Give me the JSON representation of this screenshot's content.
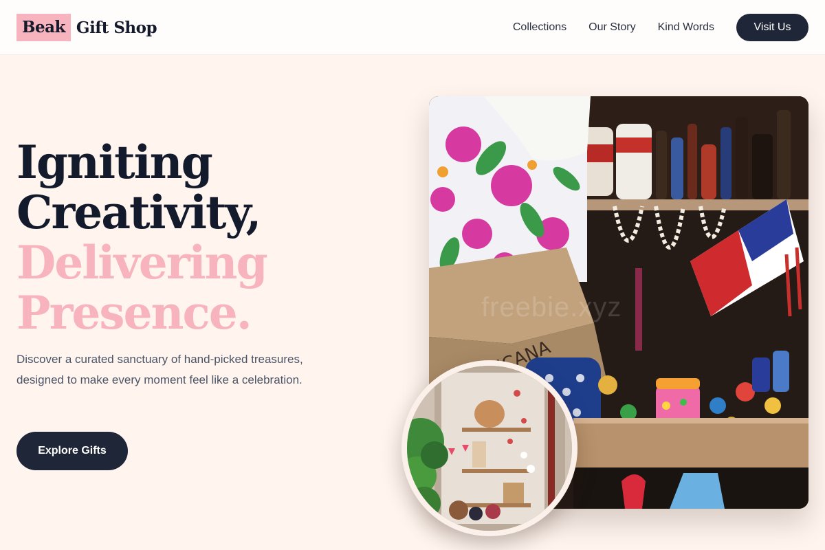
{
  "brand": {
    "mark": "Beak",
    "name": "Gift Shop"
  },
  "nav": {
    "links": [
      "Collections",
      "Our Story",
      "Kind Words"
    ],
    "cta": "Visit Us"
  },
  "hero": {
    "title_lines": [
      "Igniting",
      "Creativity,"
    ],
    "accent_lines": [
      "Delivering",
      "Presence."
    ],
    "description": "Discover a curated sanctuary of hand-picked treasures, designed to make every moment feel like a celebration.",
    "cta": "Explore Gifts"
  },
  "images": {
    "main_photo": "market stall with souvenirs, floral fabrics, shell necklaces, bottles and flags",
    "watermark": "freebie.xyz",
    "circle_photo": "gift shop storefront window with plants and decorations"
  },
  "colors": {
    "background": "#fff4ee",
    "accent_pink": "#f8b4be",
    "dark_navy": "#1f2637"
  }
}
